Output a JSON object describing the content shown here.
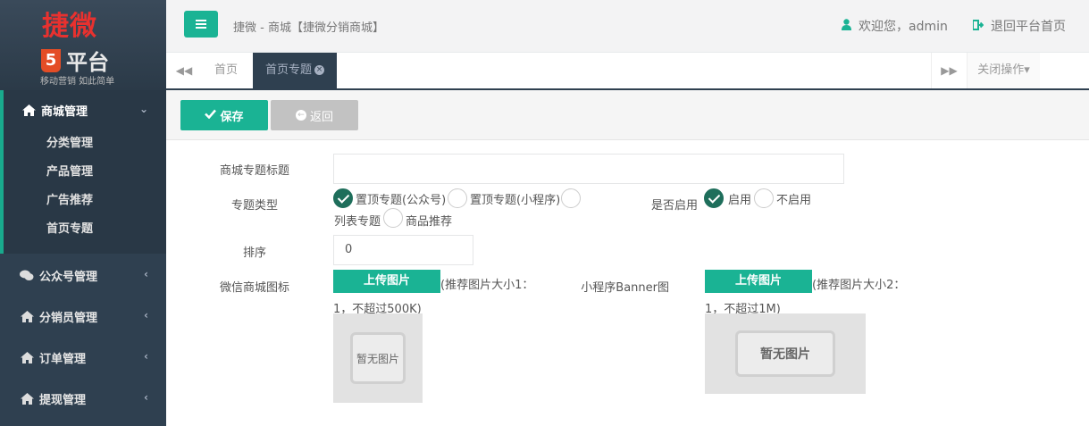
{
  "logo": {
    "main": "捷微",
    "badge": "5",
    "sub": "平台",
    "tagline": "移动营销 如此简单"
  },
  "sidebar": {
    "groups": [
      {
        "label": "商城管理",
        "items": [
          "分类管理",
          "产品管理",
          "广告推荐",
          "首页专题"
        ]
      },
      {
        "label": "公众号管理"
      },
      {
        "label": "分销员管理"
      },
      {
        "label": "订单管理"
      },
      {
        "label": "提现管理"
      }
    ]
  },
  "header": {
    "breadcrumb": "捷微 - 商城【捷微分销商城】",
    "welcome": "欢迎您，admin",
    "back_home": "退回平台首页"
  },
  "tabs": {
    "items": [
      {
        "label": "首页"
      },
      {
        "label": "首页专题"
      }
    ],
    "close_ops": "关闭操作"
  },
  "toolbar": {
    "save_label": "保存",
    "back_label": "返回"
  },
  "form": {
    "title_label": "商城专题标题",
    "title_value": "",
    "type_label": "专题类型",
    "type_options": [
      "置顶专题(公众号)",
      "置顶专题(小程序)",
      "列表专题",
      "商品推荐"
    ],
    "enable_label": "是否启用",
    "enable_options": [
      "启用",
      "不启用"
    ],
    "sort_label": "排序",
    "sort_value": "0",
    "wx_icon_label": "微信商城图标",
    "wx_upload": "上传图片",
    "wx_hint_1": "(推荐图片大小1：",
    "wx_hint_2": "1，不超过500K)",
    "wx_placeholder": "暂无图片",
    "mp_banner_label": "小程序Banner图",
    "mp_upload": "上传图片",
    "mp_hint_1": "(推荐图片大小2：",
    "mp_hint_2": "1，不超过1M)",
    "mp_placeholder": "暂无图片"
  },
  "colors": {
    "accent": "#1ab394",
    "sidebar": "#2f4050",
    "checked": "#1e6e5b"
  }
}
